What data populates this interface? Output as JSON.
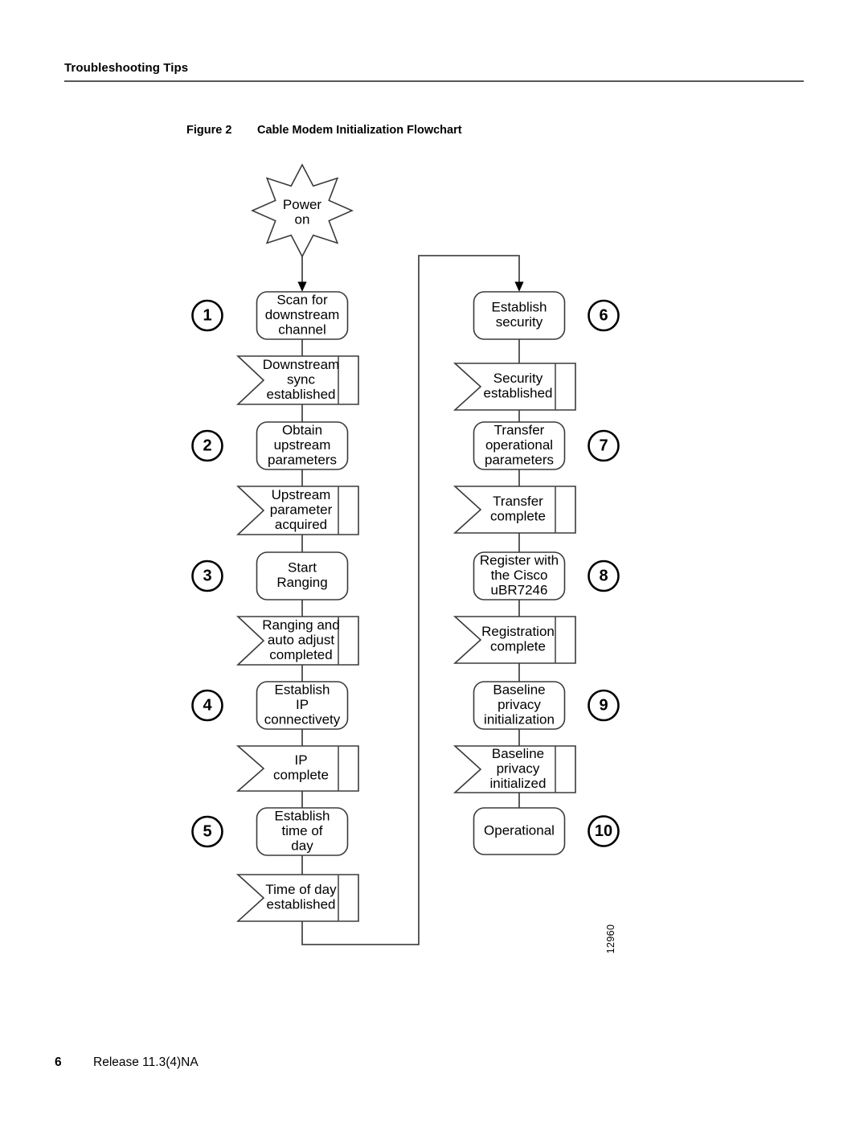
{
  "header": {
    "running_head": "Troubleshooting Tips"
  },
  "figure": {
    "number_label": "Figure 2",
    "title": "Cable Modem Initialization Flowchart",
    "figure_id": "12960"
  },
  "footer": {
    "page_number": "6",
    "release": "Release 11.3(4)NA"
  },
  "colors": {
    "rule": "#58585a",
    "shape_stroke": "#3b3b3b",
    "connector": "#4a4a4a",
    "text": "#000000",
    "background": "#ffffff"
  },
  "flowchart": {
    "type": "flowchart",
    "start_node": {
      "shape": "starburst",
      "lines": [
        "Power",
        "on"
      ]
    },
    "left_column": [
      {
        "step": "1",
        "shape": "rounded-rectangle",
        "lines": [
          "Scan for",
          "downstream",
          "channel"
        ]
      },
      {
        "step": null,
        "shape": "banner",
        "lines": [
          "Downstream",
          "sync",
          "established"
        ]
      },
      {
        "step": "2",
        "shape": "rounded-rectangle",
        "lines": [
          "Obtain",
          "upstream",
          "parameters"
        ]
      },
      {
        "step": null,
        "shape": "banner",
        "lines": [
          "Upstream",
          "parameter",
          "acquired"
        ]
      },
      {
        "step": "3",
        "shape": "rounded-rectangle",
        "lines": [
          "Start",
          "Ranging"
        ]
      },
      {
        "step": null,
        "shape": "banner",
        "lines": [
          "Ranging and",
          "auto adjust",
          "completed"
        ]
      },
      {
        "step": "4",
        "shape": "rounded-rectangle",
        "lines": [
          "Establish",
          "IP",
          "connectivety"
        ]
      },
      {
        "step": null,
        "shape": "banner",
        "lines": [
          "IP",
          "complete"
        ]
      },
      {
        "step": "5",
        "shape": "rounded-rectangle",
        "lines": [
          "Establish",
          "time of",
          "day"
        ]
      },
      {
        "step": null,
        "shape": "banner",
        "lines": [
          "Time of day",
          "established"
        ]
      }
    ],
    "right_column": [
      {
        "step": "6",
        "shape": "rounded-rectangle",
        "lines": [
          "Establish",
          "security"
        ]
      },
      {
        "step": null,
        "shape": "banner",
        "lines": [
          "Security",
          "established"
        ]
      },
      {
        "step": "7",
        "shape": "rounded-rectangle",
        "lines": [
          "Transfer",
          "operational",
          "parameters"
        ]
      },
      {
        "step": null,
        "shape": "banner",
        "lines": [
          "Transfer",
          "complete"
        ]
      },
      {
        "step": "8",
        "shape": "rounded-rectangle",
        "lines": [
          "Register with",
          "the Cisco",
          "uBR7246"
        ]
      },
      {
        "step": null,
        "shape": "banner",
        "lines": [
          "Registration",
          "complete"
        ]
      },
      {
        "step": "9",
        "shape": "rounded-rectangle",
        "lines": [
          "Baseline",
          "privacy",
          "initialization"
        ]
      },
      {
        "step": null,
        "shape": "banner",
        "lines": [
          "Baseline",
          "privacy",
          "initialized"
        ]
      },
      {
        "step": "10",
        "shape": "rounded-rectangle",
        "lines": [
          "Operational"
        ]
      }
    ]
  }
}
